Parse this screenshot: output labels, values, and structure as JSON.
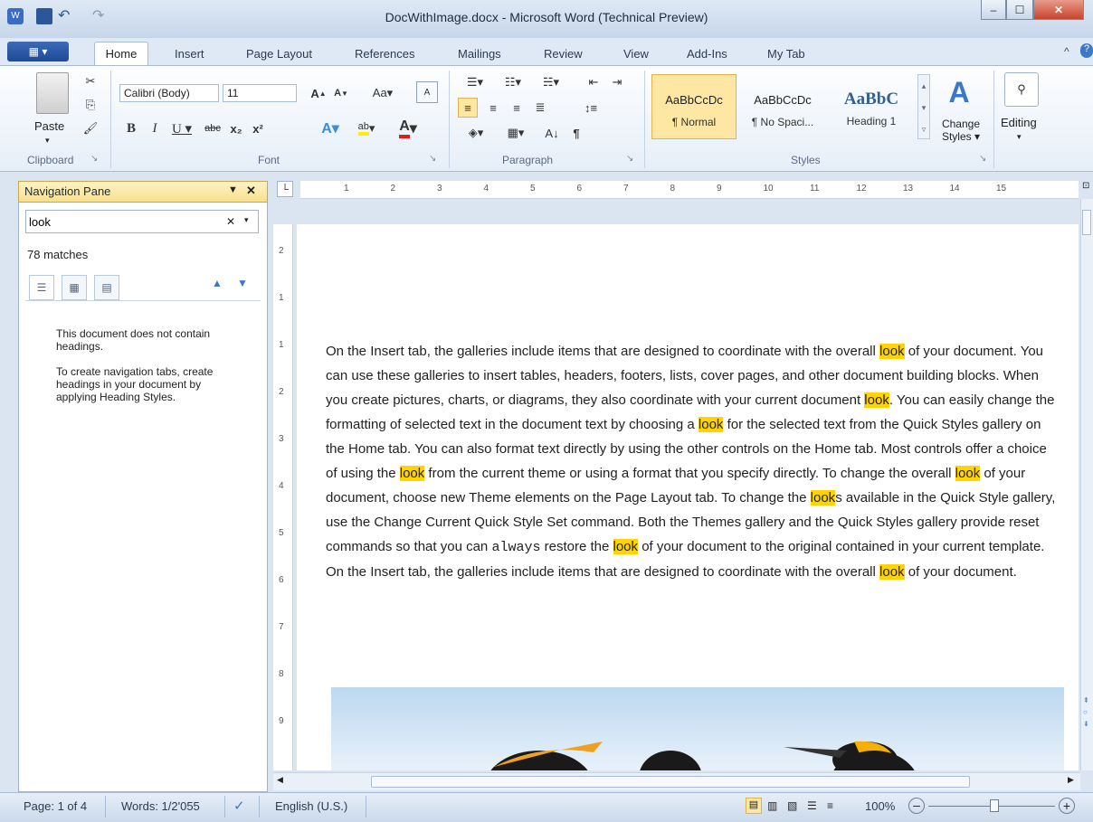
{
  "window": {
    "title": "DocWithImage.docx - Microsoft Word (Technical Preview)",
    "controls": [
      "minimize",
      "maximize",
      "close"
    ]
  },
  "quick_access": {
    "icons": [
      "word-icon",
      "save-icon",
      "undo-icon",
      "redo-icon"
    ]
  },
  "ribbon": {
    "file_label": "",
    "tabs": [
      "Home",
      "Insert",
      "Page Layout",
      "References",
      "Mailings",
      "Review",
      "View",
      "Add-Ins",
      "My Tab"
    ],
    "active_tab": "Home",
    "groups": {
      "clipboard": {
        "label": "Clipboard",
        "paste_label": "Paste"
      },
      "font": {
        "label": "Font",
        "font_name": "Calibri (Body)",
        "font_size": "11"
      },
      "paragraph": {
        "label": "Paragraph"
      },
      "styles": {
        "label": "Styles",
        "items": [
          {
            "sample": "AaBbCcDc",
            "name": "¶ Normal"
          },
          {
            "sample": "AaBbCcDc",
            "name": "¶ No Spaci..."
          },
          {
            "sample": "AaBbC",
            "name": "Heading 1"
          }
        ],
        "change_styles_label": "Change Styles ▾"
      },
      "editing": {
        "label": "Editing"
      }
    }
  },
  "nav_pane": {
    "title": "Navigation Pane",
    "search_value": "look",
    "matches": "78 matches",
    "message_1": "This document does not contain headings.",
    "message_2": "To create navigation tabs, create headings in your document by applying Heading Styles."
  },
  "ruler": {
    "marks": [
      "1",
      "2",
      "3",
      "4",
      "5",
      "6",
      "7",
      "8",
      "9",
      "10",
      "11",
      "12",
      "13",
      "14",
      "15"
    ],
    "vmarks": [
      "2",
      "1",
      "1",
      "2",
      "3",
      "4",
      "5",
      "6",
      "7",
      "8",
      "9"
    ]
  },
  "document": {
    "segments": [
      {
        "t": "On the Insert tab, the galleries include items that are designed to coordinate with the overall "
      },
      {
        "t": "look",
        "hl": true
      },
      {
        "t": " of your document. You can use these galleries to insert tables, headers, footers, lists, cover pages, and other document building blocks. When you create pictures, charts, or diagrams, they also coordinate with your current document "
      },
      {
        "t": "look",
        "hl": true
      },
      {
        "t": ". You can easily change the formatting of selected text in the document text by choosing a "
      },
      {
        "t": "look",
        "hl": true
      },
      {
        "t": " for the selected text from the Quick Styles gallery on the Home tab. You can also format text directly by using the other controls on the Home tab. Most controls offer a choice of using the "
      },
      {
        "t": "look",
        "hl": true
      },
      {
        "t": " from the current theme or using a format that you specify directly. To change the overall "
      },
      {
        "t": "look",
        "hl": true
      },
      {
        "t": " of your document, choose new Theme elements on the Page Layout tab. To change the "
      },
      {
        "t": "look",
        "hl": true
      },
      {
        "t": "s available in the Quick Style gallery, use the Change Current Quick Style Set command. Both the Themes gallery and the Quick Styles gallery provide reset commands so that you can "
      },
      {
        "t": "always",
        "mono": true
      },
      {
        "t": " restore the "
      },
      {
        "t": "look",
        "hl": true
      },
      {
        "t": " of your document to the original contained in your current template. On the Insert tab, the galleries include items that are designed to coordinate with the overall "
      },
      {
        "t": "look",
        "hl": true
      },
      {
        "t": " of your document."
      }
    ]
  },
  "status_bar": {
    "page": "Page: 1 of 4",
    "words": "Words: 1/2'055",
    "language": "English (U.S.)",
    "zoom": "100%",
    "zoom_level": 1.0
  },
  "colors": {
    "highlight": "#ffd400",
    "accent": "#2b579a"
  }
}
